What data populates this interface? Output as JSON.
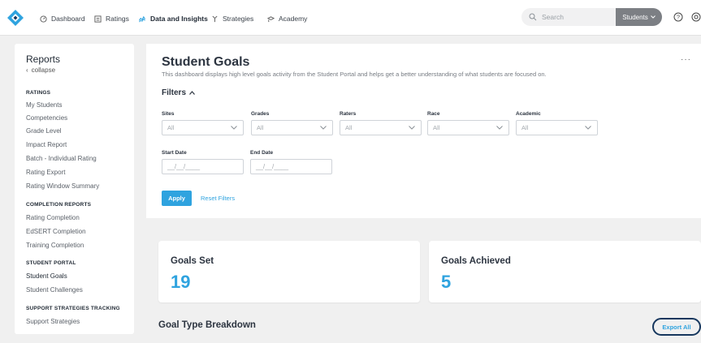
{
  "nav": {
    "items": [
      {
        "label": "Dashboard",
        "icon": "dashboard-icon"
      },
      {
        "label": "Ratings",
        "icon": "ratings-icon"
      },
      {
        "label": "Data and Insights",
        "icon": "insights-icon",
        "active": true
      },
      {
        "label": "Strategies",
        "icon": "strategies-icon"
      },
      {
        "label": "Academy",
        "icon": "academy-icon"
      }
    ],
    "search_placeholder": "Search",
    "students_label": "Students"
  },
  "sidebar": {
    "title": "Reports",
    "collapse_label": "collapse",
    "sections": [
      {
        "title": "RATINGS",
        "items": [
          "My Students",
          "Competencies",
          "Grade Level",
          "Impact Report",
          "Batch - Individual Rating",
          "Rating Export",
          "Rating Window Summary"
        ]
      },
      {
        "title": "COMPLETION REPORTS",
        "items": [
          "Rating Completion",
          "EdSERT Completion",
          "Training Completion"
        ]
      },
      {
        "title": "STUDENT PORTAL",
        "items": [
          "Student Goals",
          "Student Challenges"
        ]
      },
      {
        "title": "SUPPORT STRATEGIES TRACKING",
        "items": [
          "Support Strategies"
        ]
      }
    ],
    "active_item": "Student Goals"
  },
  "main": {
    "title": "Student Goals",
    "description": "This dashboard displays high level goals activity from the Student Portal and helps get a better understanding of what students are focused on.",
    "more_label": "···",
    "filters": {
      "heading": "Filters",
      "selects": [
        {
          "label": "Sites",
          "value": "All"
        },
        {
          "label": "Grades",
          "value": "All"
        },
        {
          "label": "Raters",
          "value": "All"
        },
        {
          "label": "Race",
          "value": "All"
        },
        {
          "label": "Academic",
          "value": "All"
        }
      ],
      "dates": [
        {
          "label": "Start Date",
          "placeholder": "__/__/____"
        },
        {
          "label": "End Date",
          "placeholder": "__/__/____"
        }
      ],
      "apply_label": "Apply",
      "reset_label": "Reset Filters"
    },
    "cards": [
      {
        "title": "Goals Set",
        "value": "19"
      },
      {
        "title": "Goals Achieved",
        "value": "5"
      }
    ],
    "breakdown_title": "Goal Type Breakdown",
    "export_label": "Export All"
  },
  "colors": {
    "accent": "#2fa3df",
    "text": "#2c3440",
    "export_outline": "#16375e"
  }
}
